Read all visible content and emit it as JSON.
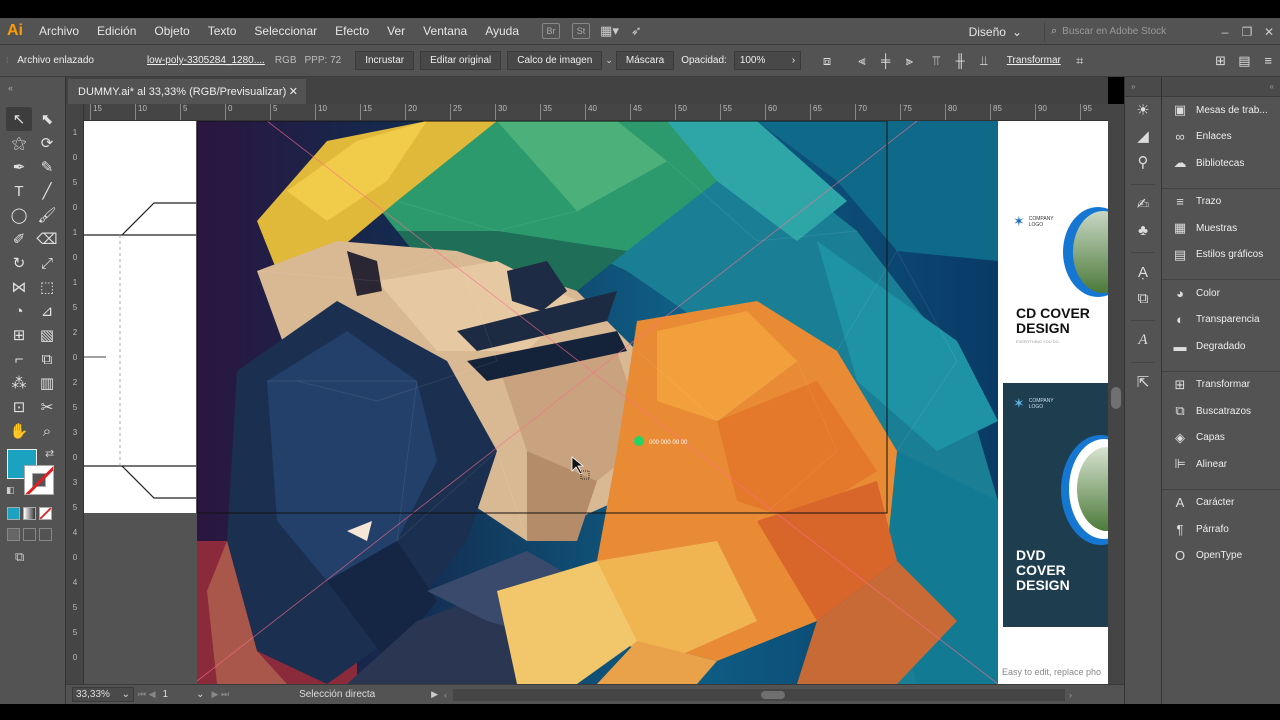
{
  "app": {
    "logo": "Ai"
  },
  "menu": {
    "items": [
      "Archivo",
      "Edición",
      "Objeto",
      "Texto",
      "Seleccionar",
      "Efecto",
      "Ver",
      "Ventana",
      "Ayuda"
    ],
    "bridge": "Br",
    "stock": "St",
    "workspace": "Diseño",
    "stock_search_placeholder": "Buscar en Adobe Stock"
  },
  "control": {
    "object_type": "Archivo enlazado",
    "file_name": "low-poly-3305284_1280....",
    "color_mode": "RGB",
    "ppi": "PPP: 72",
    "embed": "Incrustar",
    "edit_original": "Editar original",
    "image_trace": "Calco de imagen",
    "mask": "Máscara",
    "opacity_label": "Opacidad:",
    "opacity_value": "100%",
    "transform": "Transformar"
  },
  "document": {
    "tab_title": "DUMMY.ai* al 33,33% (RGB/Previsualizar)"
  },
  "rulers": {
    "h": [
      "15",
      "10",
      "5",
      "0",
      "5",
      "10",
      "15",
      "20",
      "25",
      "30",
      "35",
      "40",
      "45",
      "50",
      "55",
      "60",
      "65",
      "70",
      "75",
      "80",
      "85",
      "90",
      "95"
    ],
    "v": [
      "1",
      "0",
      "5",
      "0",
      "1",
      "0",
      "1",
      "5",
      "2",
      "0",
      "2",
      "5",
      "3",
      "0",
      "3",
      "5",
      "4",
      "0",
      "4",
      "5",
      "5",
      "0"
    ]
  },
  "artwork": {
    "phone_label": "000 000 00 00"
  },
  "mockup": {
    "company_logo": "COMPANY LOGO",
    "cd_title_1": "CD COVER",
    "cd_title_2": "DESIGN",
    "cd_tagline": "EVERYTHING YOU DO",
    "dvd_title_1": "DVD",
    "dvd_title_2": "COVER",
    "dvd_title_3": "DESIGN",
    "footer": "Easy to edit, replace pho"
  },
  "status": {
    "zoom": "33,33%",
    "page": "1",
    "tool": "Selección directa"
  },
  "panels": [
    {
      "icon": "artboards-icon",
      "glyph": "▣",
      "label": "Mesas de trab..."
    },
    {
      "icon": "links-icon",
      "glyph": "∞",
      "label": "Enlaces"
    },
    {
      "icon": "libraries-icon",
      "glyph": "☁",
      "label": "Bibliotecas"
    },
    {
      "icon": "stroke-icon",
      "glyph": "≡",
      "label": "Trazo"
    },
    {
      "icon": "swatches-icon",
      "glyph": "▦",
      "label": "Muestras"
    },
    {
      "icon": "graphic-styles-icon",
      "glyph": "▤",
      "label": "Estilos gráficos"
    },
    {
      "icon": "color-icon",
      "glyph": "◕",
      "label": "Color"
    },
    {
      "icon": "transparency-icon",
      "glyph": "◐",
      "label": "Transparencia"
    },
    {
      "icon": "gradient-icon",
      "glyph": "▬",
      "label": "Degradado"
    },
    {
      "icon": "transform-icon",
      "glyph": "⊞",
      "label": "Transformar"
    },
    {
      "icon": "pathfinder-icon",
      "glyph": "⧉",
      "label": "Buscatrazos"
    },
    {
      "icon": "layers-icon",
      "glyph": "◈",
      "label": "Capas"
    },
    {
      "icon": "align-icon",
      "glyph": "⊫",
      "label": "Alinear"
    },
    {
      "icon": "character-icon",
      "glyph": "A",
      "label": "Carácter"
    },
    {
      "icon": "paragraph-icon",
      "glyph": "¶",
      "label": "Párrafo"
    },
    {
      "icon": "opentype-icon",
      "glyph": "O",
      "label": "OpenType"
    }
  ]
}
